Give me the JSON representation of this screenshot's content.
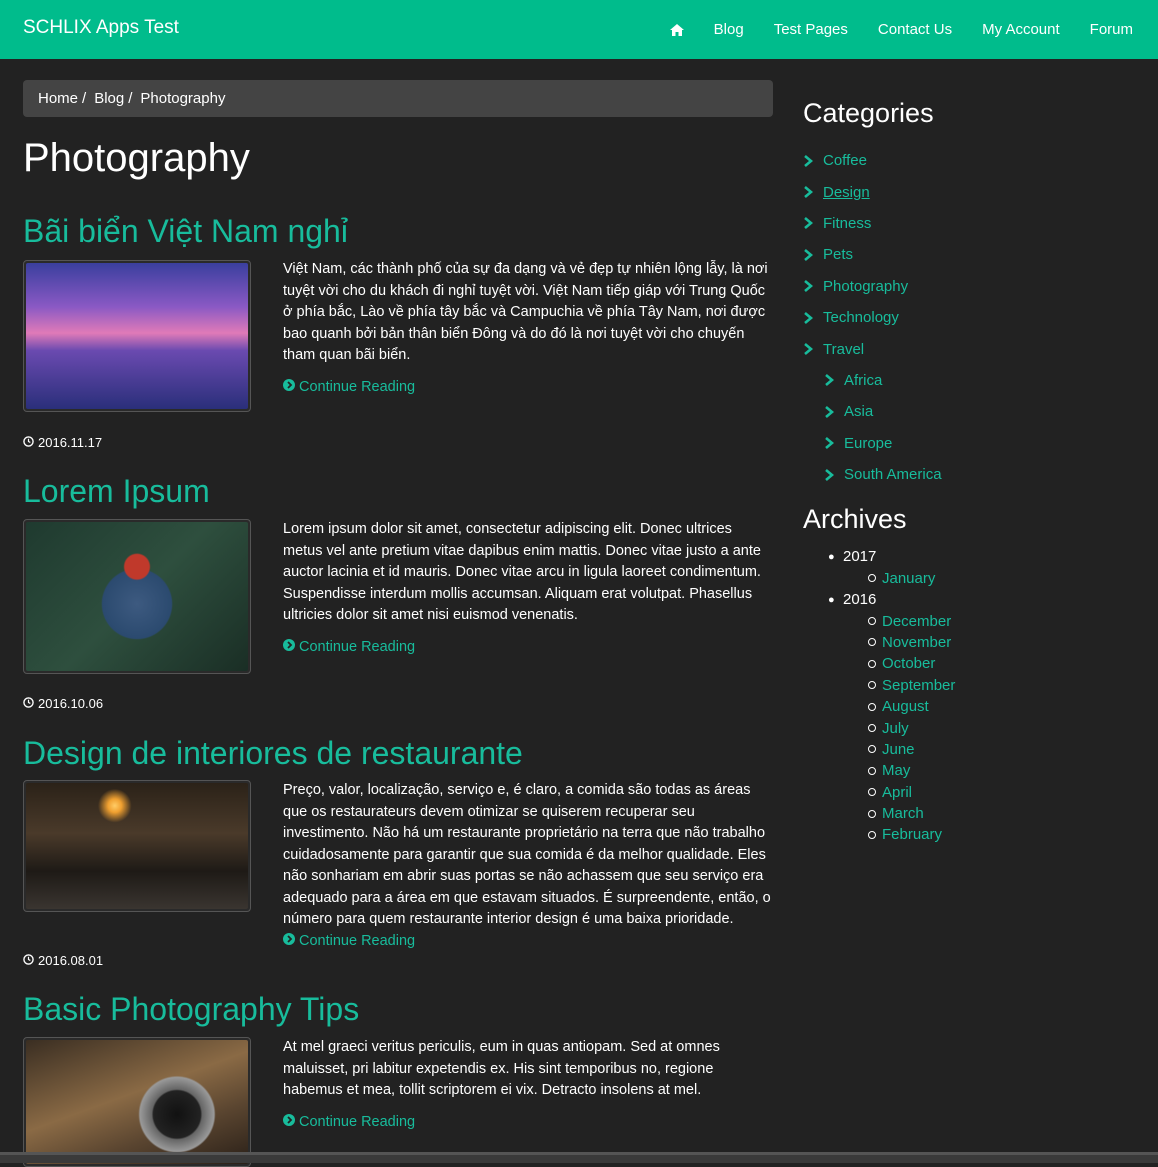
{
  "navbar": {
    "brand": "SCHLIX Apps Test",
    "items": [
      "Blog",
      "Test Pages",
      "Contact Us",
      "My Account",
      "Forum"
    ]
  },
  "breadcrumb": [
    "Home",
    "Blog",
    "Photography"
  ],
  "page_title": "Photography",
  "posts": [
    {
      "title": "Bãi biển Việt Nam nghỉ",
      "excerpt": "Việt Nam, các thành phố của sự đa dạng và vẻ đẹp tự nhiên lộng lẫy, là nơi tuyệt vời cho du khách đi nghỉ tuyệt vời. Việt Nam tiếp giáp với Trung Quốc ở phía bắc, Lào về phía tây bắc và Campuchia về phía Tây Nam, nơi được bao quanh bởi bản thân biển Đông và do đó là nơi tuyệt vời cho chuyến tham quan bãi biển.",
      "more": "Continue Reading",
      "date": "2016.11.17"
    },
    {
      "title": "Lorem Ipsum",
      "excerpt": "Lorem ipsum dolor sit amet, consectetur adipiscing elit. Donec ultrices metus vel ante pretium vitae dapibus enim mattis. Donec vitae justo a ante auctor lacinia et id mauris. Donec vitae arcu in ligula laoreet condimentum. Suspendisse interdum mollis accumsan. Aliquam erat volutpat. Phasellus ultricies dolor sit amet nisi euismod venenatis.",
      "more": "Continue Reading",
      "date": "2016.10.06"
    },
    {
      "title": "Design de interiores de restaurante",
      "excerpt": "Preço, valor, localização, serviço e, é claro, a comida são todas as áreas que os restaurateurs devem otimizar se quiserem recuperar seu investimento. Não há um restaurante proprietário na terra que não trabalho cuidadosamente para garantir que sua comida é da melhor qualidade. Eles não sonhariam em abrir suas portas se não achassem que seu serviço era adequado para a área em que estavam situados. É surpreendente, então, o número para quem restaurante interior design é uma baixa prioridade.",
      "more": "Continue Reading",
      "date": "2016.08.01"
    },
    {
      "title": "Basic Photography Tips",
      "excerpt": "At mel graeci veritus periculis, eum in quas antiopam. Sed at omnes maluisset, pri labitur expetendis ex. His sint temporibus no, regione habemus et mea, tollit scriptorem ei vix. Detracto insolens at mel.",
      "more": "Continue Reading"
    }
  ],
  "sidebar": {
    "categories_title": "Categories",
    "categories": [
      "Coffee",
      "Design",
      "Fitness",
      "Pets",
      "Photography",
      "Technology",
      "Travel"
    ],
    "travel_children": [
      "Africa",
      "Asia",
      "Europe",
      "South America"
    ],
    "archives_title": "Archives",
    "archives": [
      {
        "year": "2017",
        "months": [
          "January"
        ]
      },
      {
        "year": "2016",
        "months": [
          "December",
          "November",
          "October",
          "September",
          "August",
          "July",
          "June",
          "May",
          "April",
          "March",
          "February"
        ]
      }
    ]
  },
  "colors": {
    "navbar": "#00bc8c",
    "link": "#18bc9c",
    "background": "#222222",
    "breadcrumb": "#444444"
  }
}
